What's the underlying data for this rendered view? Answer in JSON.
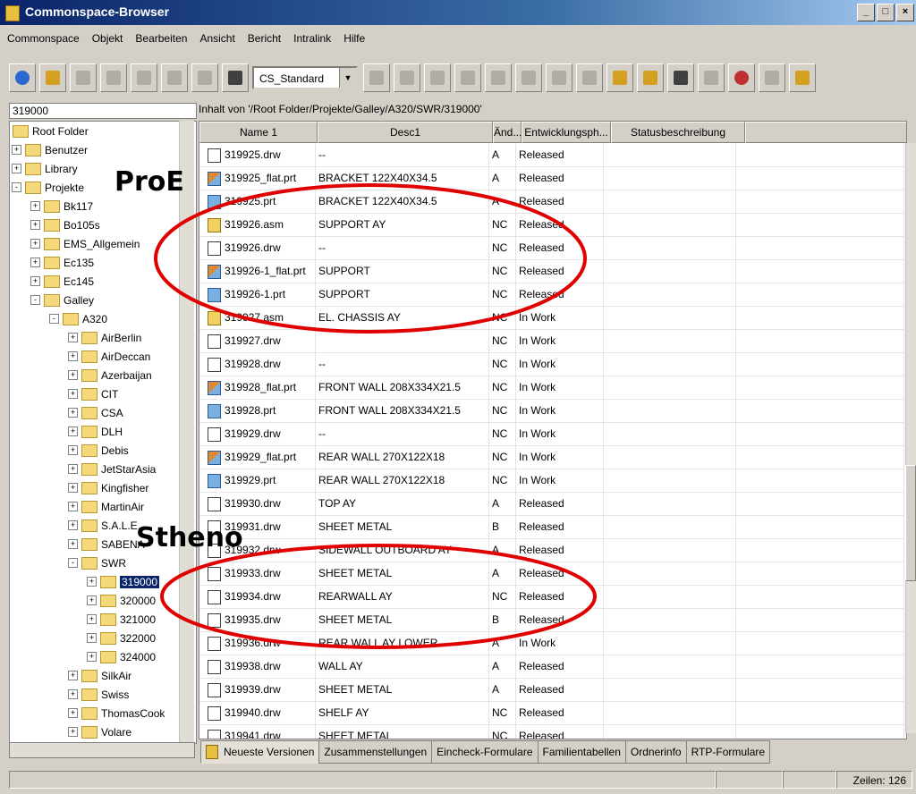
{
  "window": {
    "title": "Commonspace-Browser",
    "controls": [
      "_",
      "□",
      "×"
    ]
  },
  "menu": [
    "Commonspace",
    "Objekt",
    "Bearbeiten",
    "Ansicht",
    "Bericht",
    "Intralink",
    "Hilfe"
  ],
  "toolbar": {
    "view_select": "CS_Standard"
  },
  "left_path": "319000",
  "content_path": "Inhalt von '/Root Folder/Projekte/Galley/A320/SWR/319000'",
  "tree": [
    {
      "label": "Root Folder",
      "level": 0,
      "exp": ""
    },
    {
      "label": "Benutzer",
      "level": 0,
      "exp": "+"
    },
    {
      "label": "Library",
      "level": 0,
      "exp": "+"
    },
    {
      "label": "Projekte",
      "level": 0,
      "exp": "-"
    },
    {
      "label": "Bk117",
      "level": 1,
      "exp": "+"
    },
    {
      "label": "Bo105s",
      "level": 1,
      "exp": "+"
    },
    {
      "label": "EMS_Allgemein",
      "level": 1,
      "exp": "+"
    },
    {
      "label": "Ec135",
      "level": 1,
      "exp": "+"
    },
    {
      "label": "Ec145",
      "level": 1,
      "exp": "+"
    },
    {
      "label": "Galley",
      "level": 1,
      "exp": "-"
    },
    {
      "label": "A320",
      "level": 2,
      "exp": "-"
    },
    {
      "label": "AirBerlin",
      "level": 3,
      "exp": "+"
    },
    {
      "label": "AirDeccan",
      "level": 3,
      "exp": "+"
    },
    {
      "label": "Azerbaijan",
      "level": 3,
      "exp": "+"
    },
    {
      "label": "CIT",
      "level": 3,
      "exp": "+"
    },
    {
      "label": "CSA",
      "level": 3,
      "exp": "+"
    },
    {
      "label": "DLH",
      "level": 3,
      "exp": "+"
    },
    {
      "label": "Debis",
      "level": 3,
      "exp": "+"
    },
    {
      "label": "JetStarAsia",
      "level": 3,
      "exp": "+"
    },
    {
      "label": "Kingfisher",
      "level": 3,
      "exp": "+"
    },
    {
      "label": "MartinAir",
      "level": 3,
      "exp": "+"
    },
    {
      "label": "S.A.L.E.",
      "level": 3,
      "exp": "+"
    },
    {
      "label": "SABENA",
      "level": 3,
      "exp": "+"
    },
    {
      "label": "SWR",
      "level": 3,
      "exp": "-"
    },
    {
      "label": "319000",
      "level": 4,
      "exp": "+",
      "selected": true
    },
    {
      "label": "320000",
      "level": 4,
      "exp": "+"
    },
    {
      "label": "321000",
      "level": 4,
      "exp": "+"
    },
    {
      "label": "322000",
      "level": 4,
      "exp": "+"
    },
    {
      "label": "324000",
      "level": 4,
      "exp": "+"
    },
    {
      "label": "SilkAir",
      "level": 3,
      "exp": "+"
    },
    {
      "label": "Swiss",
      "level": 3,
      "exp": "+"
    },
    {
      "label": "ThomasCook",
      "level": 3,
      "exp": "+"
    },
    {
      "label": "Volare",
      "level": 3,
      "exp": "+"
    }
  ],
  "columns": [
    "Name    1",
    "Desc1",
    "Änd...",
    "Entwicklungsph...",
    "Statusbeschreibung"
  ],
  "rows": [
    {
      "type": "drw",
      "name": "319925.drw",
      "desc": "--",
      "rev": "A",
      "phase": "Released"
    },
    {
      "type": "flat",
      "name": "319925_flat.prt",
      "desc": "BRACKET 122X40X34.5",
      "rev": "A",
      "phase": "Released"
    },
    {
      "type": "prt",
      "name": "319925.prt",
      "desc": "BRACKET 122X40X34.5",
      "rev": "A",
      "phase": "Released"
    },
    {
      "type": "asm",
      "name": "319926.asm",
      "desc": "SUPPORT AY",
      "rev": "NC",
      "phase": "Released"
    },
    {
      "type": "drw",
      "name": "319926.drw",
      "desc": "--",
      "rev": "NC",
      "phase": "Released"
    },
    {
      "type": "flat",
      "name": "319926-1_flat.prt",
      "desc": "SUPPORT",
      "rev": "NC",
      "phase": "Released"
    },
    {
      "type": "prt",
      "name": "319926-1.prt",
      "desc": "SUPPORT",
      "rev": "NC",
      "phase": "Released"
    },
    {
      "type": "asm",
      "name": "319927.asm",
      "desc": "EL. CHASSIS AY",
      "rev": "NC",
      "phase": "In Work"
    },
    {
      "type": "drw",
      "name": "319927.drw",
      "desc": "",
      "rev": "NC",
      "phase": "In Work"
    },
    {
      "type": "drw",
      "name": "319928.drw",
      "desc": "--",
      "rev": "NC",
      "phase": "In Work"
    },
    {
      "type": "flat",
      "name": "319928_flat.prt",
      "desc": "FRONT WALL 208X334X21.5",
      "rev": "NC",
      "phase": "In Work"
    },
    {
      "type": "prt",
      "name": "319928.prt",
      "desc": "FRONT WALL 208X334X21.5",
      "rev": "NC",
      "phase": "In Work"
    },
    {
      "type": "drw",
      "name": "319929.drw",
      "desc": "--",
      "rev": "NC",
      "phase": "In Work"
    },
    {
      "type": "flat",
      "name": "319929_flat.prt",
      "desc": "REAR WALL 270X122X18",
      "rev": "NC",
      "phase": "In Work"
    },
    {
      "type": "prt",
      "name": "319929.prt",
      "desc": "REAR WALL 270X122X18",
      "rev": "NC",
      "phase": "In Work"
    },
    {
      "type": "drw",
      "name": "319930.drw",
      "desc": "TOP AY",
      "rev": "A",
      "phase": "Released"
    },
    {
      "type": "drw",
      "name": "319931.drw",
      "desc": "SHEET METAL",
      "rev": "B",
      "phase": "Released"
    },
    {
      "type": "drw",
      "name": "319932.drw",
      "desc": "SIDEWALL OUTBOARD AY",
      "rev": "A",
      "phase": "Released"
    },
    {
      "type": "drw",
      "name": "319933.drw",
      "desc": "SHEET METAL",
      "rev": "A",
      "phase": "Released"
    },
    {
      "type": "drw",
      "name": "319934.drw",
      "desc": "REARWALL AY",
      "rev": "NC",
      "phase": "Released"
    },
    {
      "type": "drw",
      "name": "319935.drw",
      "desc": "SHEET METAL",
      "rev": "B",
      "phase": "Released"
    },
    {
      "type": "drw",
      "name": "319936.drw",
      "desc": "REAR WALL AY LOWER",
      "rev": "A",
      "phase": "In Work"
    },
    {
      "type": "drw",
      "name": "319938.drw",
      "desc": "WALL AY",
      "rev": "A",
      "phase": "Released"
    },
    {
      "type": "drw",
      "name": "319939.drw",
      "desc": "SHEET METAL",
      "rev": "A",
      "phase": "Released"
    },
    {
      "type": "drw",
      "name": "319940.drw",
      "desc": "SHELF AY",
      "rev": "NC",
      "phase": "Released"
    },
    {
      "type": "drw",
      "name": "319941.drw",
      "desc": "SHEET METAL",
      "rev": "NC",
      "phase": "Released"
    }
  ],
  "tabs": [
    "Neueste Versionen",
    "Zusammenstellungen",
    "Eincheck-Formulare",
    "Familientabellen",
    "Ordnerinfo",
    "RTP-Formulare"
  ],
  "status": {
    "rows_label": "Zeilen: 126"
  },
  "annotations": {
    "label_top": "ProE",
    "label_bottom": "Stheno",
    "ellipse_color": "#e00000"
  }
}
